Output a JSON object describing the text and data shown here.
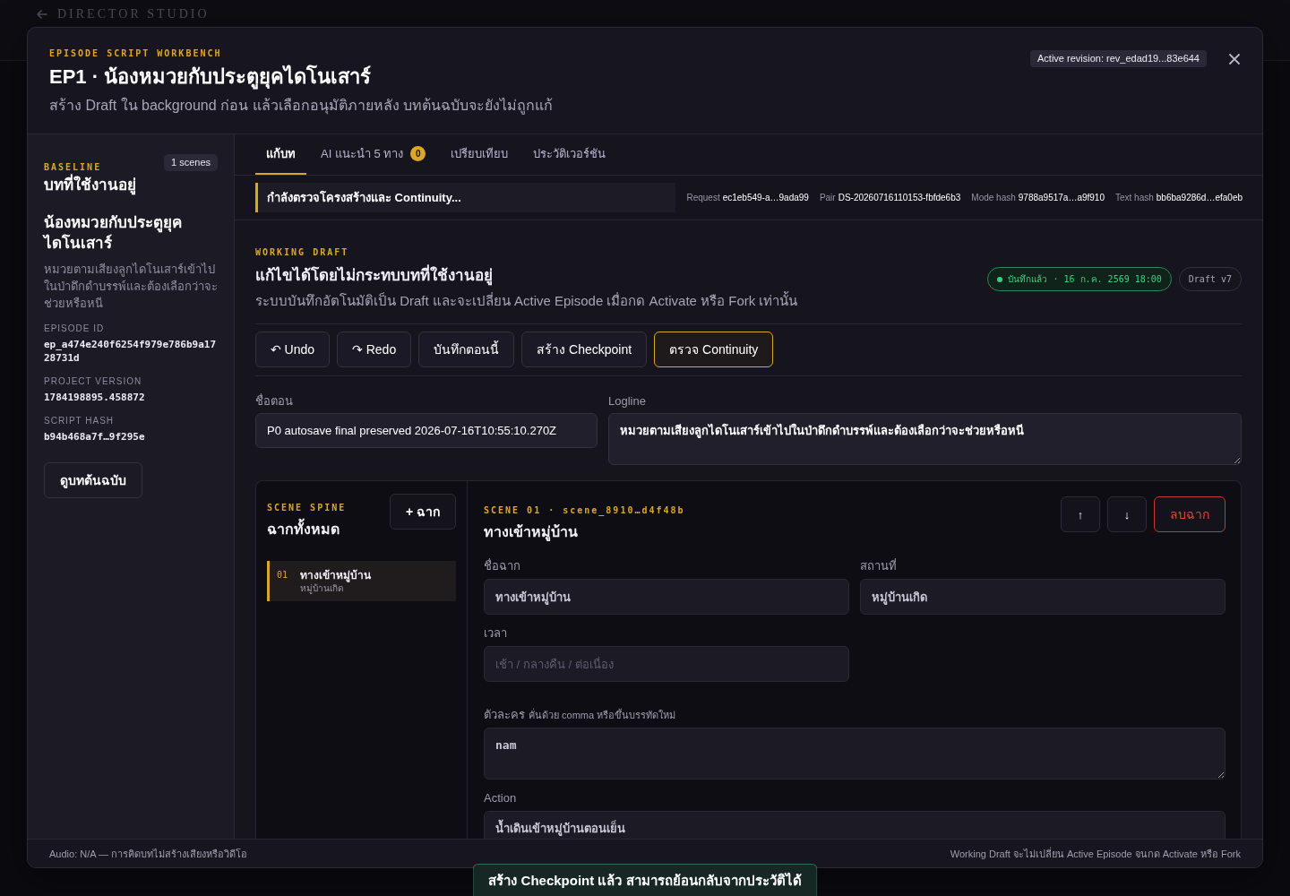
{
  "backdrop": {
    "app_title": "DIRECTOR STUDIO"
  },
  "header": {
    "eyebrow": "EPISODE SCRIPT WORKBENCH",
    "title": "EP1 · น้องหมวยกับประตูยุคไดโนเสาร์",
    "subtitle": "สร้าง Draft ใน background ก่อน แล้วเลือกอนุมัติภายหลัง บทต้นฉบับจะยังไม่ถูกแก้",
    "revision": "Active revision: rev_edad19...83e644"
  },
  "sidebar": {
    "eyebrow": "BASELINE",
    "scene_count": "1 scenes",
    "heading": "บทที่ใช้งานอยู่",
    "episode_title": "น้องหมวยกับประตูยุคไดโนเสาร์",
    "logline": "หมวยตามเสียงลูกไดโนเสาร์เข้าไปในป่าดึกดำบรรพ์และต้องเลือกว่าจะช่วยหรือหนี",
    "meta": [
      {
        "label": "EPISODE ID",
        "value": "ep_a474e240f6254f979e786b9a1728731d"
      },
      {
        "label": "PROJECT VERSION",
        "value": "1784198895.458872"
      },
      {
        "label": "SCRIPT HASH",
        "value": "b94b468a7f…9f295e"
      }
    ],
    "button": "ดูบทต้นฉบับ"
  },
  "tabs": [
    {
      "label": "แก้บท",
      "selected": true
    },
    {
      "label": "AI แนะนำ 5 ทาง",
      "badge": "0",
      "selected": false
    },
    {
      "label": "เปรียบเทียบ",
      "selected": false
    },
    {
      "label": "ประวัติเวอร์ชัน",
      "selected": false
    }
  ],
  "status": {
    "message": "กำลังตรวจโครงสร้างและ Continuity...",
    "meta": [
      {
        "label": "Request",
        "value": "ec1eb549-a…9ada99"
      },
      {
        "label": "Pair",
        "value": "DS-20260716110153-fbfde6b3"
      },
      {
        "label": "Mode hash",
        "value": "9788a9517a…a9f910"
      },
      {
        "label": "Text hash",
        "value": "bb6ba9286d…efa0eb"
      }
    ]
  },
  "draft": {
    "eyebrow": "WORKING DRAFT",
    "title": "แก้ไขได้โดยไม่กระทบบทที่ใช้งานอยู่",
    "description": "ระบบบันทึกอัตโนมัติเป็น Draft และจะเปลี่ยน Active Episode เมื่อกด Activate หรือ Fork เท่านั้น",
    "save_status": {
      "text": "บันทึกแล้ว · 16 ก.ค. 2569 18:00",
      "saved": true
    },
    "version": "Draft v7",
    "actions": [
      {
        "label": "↶ Undo",
        "active": false
      },
      {
        "label": "↷ Redo",
        "active": false
      },
      {
        "label": "บันทึกตอนนี้",
        "active": false
      },
      {
        "label": "สร้าง Checkpoint",
        "active": false
      },
      {
        "label": "ตรวจ Continuity",
        "active": true
      }
    ],
    "fields": [
      {
        "kind": "input",
        "label": "ชื่อตอน",
        "value": "P0 autosave final preserved 2026-07-16T10:55:10.270Z"
      },
      {
        "kind": "textarea",
        "label": "Logline",
        "value": "หมวยตามเสียงลูกไดโนเสาร์เข้าไปในป่าดึกดำบรรพ์และต้องเลือกว่าจะช่วยหรือหนี"
      }
    ]
  },
  "scene_spine": {
    "eyebrow": "SCENE SPINE",
    "title": "ฉากทั้งหมด",
    "add_button": "+ ฉาก",
    "scenes": [
      {
        "number": "01",
        "title": "ทางเข้าหมู่บ้าน",
        "location": "หมู่บ้านเกิด",
        "selected": true
      }
    ]
  },
  "scene_editor": {
    "eyebrow": "SCENE 01 · scene_8910…d4f48b",
    "title": "ทางเข้าหมู่บ้าน",
    "controls": [
      {
        "kind": "up",
        "label": "↑"
      },
      {
        "kind": "down",
        "label": "↓"
      },
      {
        "kind": "delete",
        "label": "ลบฉาก"
      }
    ],
    "fields": [
      {
        "kind": "input",
        "label": "ชื่อฉาก",
        "value": "ทางเข้าหมู่บ้าน"
      },
      {
        "kind": "input",
        "label": "สถานที่",
        "value": "หมู่บ้านเกิด"
      },
      {
        "kind": "input",
        "label": "เวลา",
        "placeholder": "เช้า / กลางคืน / ต่อเนื่อง"
      },
      {
        "kind": "list",
        "label": "ตัวละคร",
        "hint": "คั่นด้วย comma หรือขึ้นบรรทัดใหม่",
        "value": "nam"
      },
      {
        "kind": "textarea",
        "label": "Action",
        "value": "น้ำเดินเข้าหมู่บ้านตอนเย็น"
      }
    ]
  },
  "footer": {
    "left": "Audio: N/A — การคิดบทไม่สร้างเสียงหรือวิดีโอ",
    "right": "Working Draft จะไม่เปลี่ยน Active Episode จนกด Activate หรือ Fork"
  },
  "toast": {
    "message": "สร้าง Checkpoint แล้ว สามารถย้อนกลับจากประวัติได้"
  }
}
